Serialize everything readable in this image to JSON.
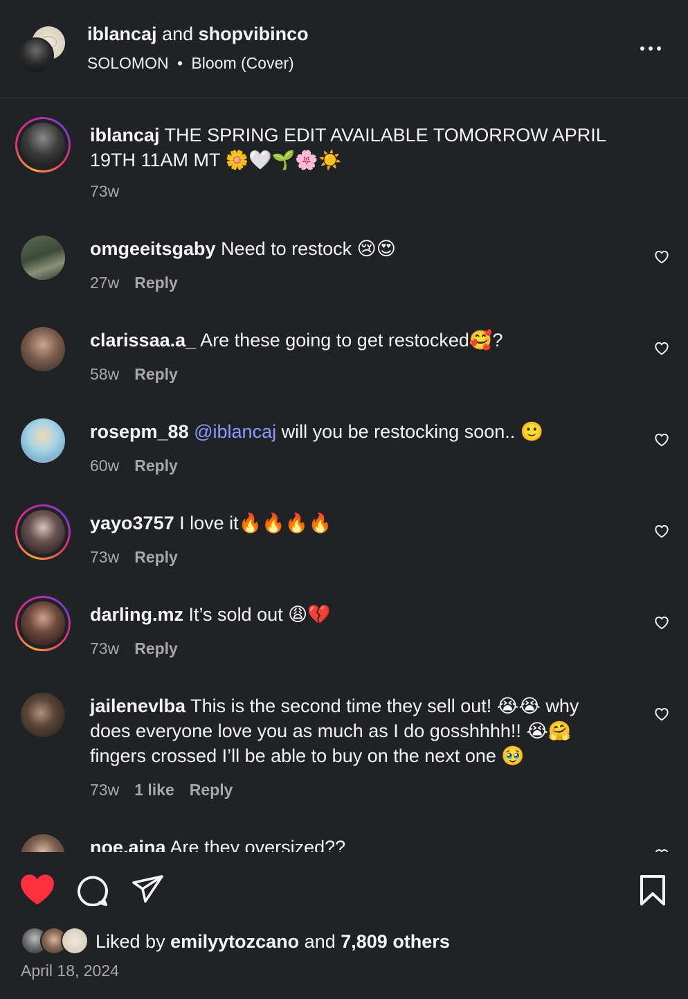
{
  "header": {
    "user1": "iblancaj",
    "and": "and",
    "user2": "shopvibinco",
    "audio_artist": "SOLOMON",
    "audio_sep": "•",
    "audio_track": "Bloom (Cover)",
    "more_icon": "more-horizontal-icon"
  },
  "caption": {
    "username": "iblancaj",
    "text": "THE SPRING EDIT AVAILABLE TOMORROW APRIL 19TH 11AM MT 🌼🤍🌱🌸☀️",
    "time": "73w"
  },
  "comments": [
    {
      "username": "omgeeitsgaby",
      "text": "Need to restock 😢😍",
      "time": "27w",
      "reply": "Reply"
    },
    {
      "username": "clarissaa.a_",
      "text": "Are these going to get restocked🥰?",
      "time": "58w",
      "reply": "Reply"
    },
    {
      "username": "rosepm_88",
      "mention": "@iblancaj",
      "text": "will you be restocking soon.. 🙂",
      "time": "60w",
      "reply": "Reply"
    },
    {
      "username": "yayo3757",
      "text": "I love it🔥🔥🔥🔥",
      "time": "73w",
      "reply": "Reply"
    },
    {
      "username": "darling.mz",
      "text": "It’s sold out 😩💔",
      "time": "73w",
      "reply": "Reply"
    },
    {
      "username": "jailenevlba",
      "text": "This is the second time they sell out! 😭😭 why does everyone love you as much as I do gosshhhh!! 😭🤗 fingers crossed I’ll be able to buy on the next one 🥹",
      "time": "73w",
      "likes": "1 like",
      "reply": "Reply"
    },
    {
      "username": "noe.aina",
      "text": "Are they oversized??"
    }
  ],
  "actions": {
    "like_icon": "heart-filled-icon",
    "comment_icon": "comment-icon",
    "share_icon": "share-icon",
    "save_icon": "bookmark-icon",
    "like_color": "#ff3040"
  },
  "likes": {
    "prefix": "Liked by",
    "user": "emilyytozcano",
    "and": "and",
    "others": "7,809 others"
  },
  "date": "April 18, 2024"
}
